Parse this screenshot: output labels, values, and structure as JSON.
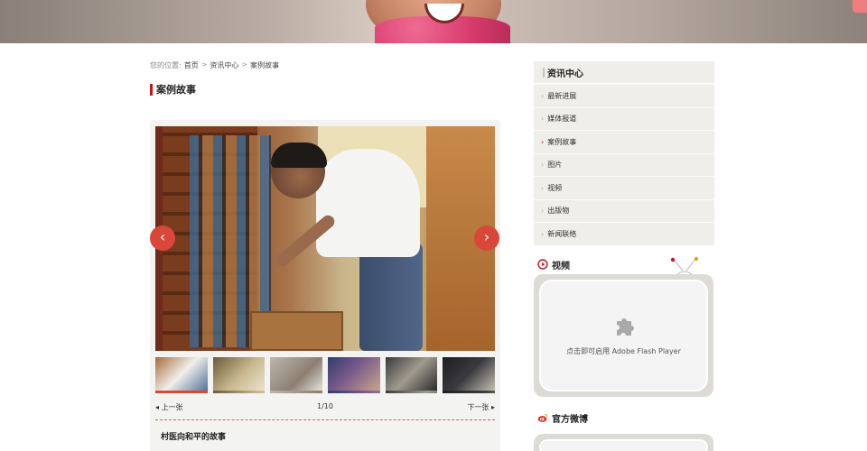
{
  "breadcrumb": {
    "prefix": "您的位置:",
    "items": [
      "首页",
      "资讯中心",
      "案例故事"
    ],
    "separator": ">"
  },
  "page_title": "案例故事",
  "gallery": {
    "prev_arrow": "‹",
    "next_arrow": "›",
    "prev_label": "上一张",
    "next_label": "下一张",
    "counter": "1/10",
    "story_title": "村医向和平的故事",
    "thumbnail_count": 6,
    "active_thumbnail": 1
  },
  "sidebar": {
    "title": "资讯中心",
    "items": [
      {
        "label": "最新进展",
        "active": false
      },
      {
        "label": "媒体报道",
        "active": false
      },
      {
        "label": "案例故事",
        "active": true
      },
      {
        "label": "图片",
        "active": false
      },
      {
        "label": "视频",
        "active": false
      },
      {
        "label": "出版物",
        "active": false
      },
      {
        "label": "新闻联络",
        "active": false
      }
    ]
  },
  "video": {
    "title": "视频",
    "plugin_text": "点击即可启用 Adobe Flash Player",
    "icon": "play-circle-icon"
  },
  "weibo": {
    "title": "官方微博",
    "icon": "weibo-icon"
  },
  "colors": {
    "accent": "#c8161d",
    "arrow": "#d8473a",
    "menu_bg": "#efeeea"
  }
}
